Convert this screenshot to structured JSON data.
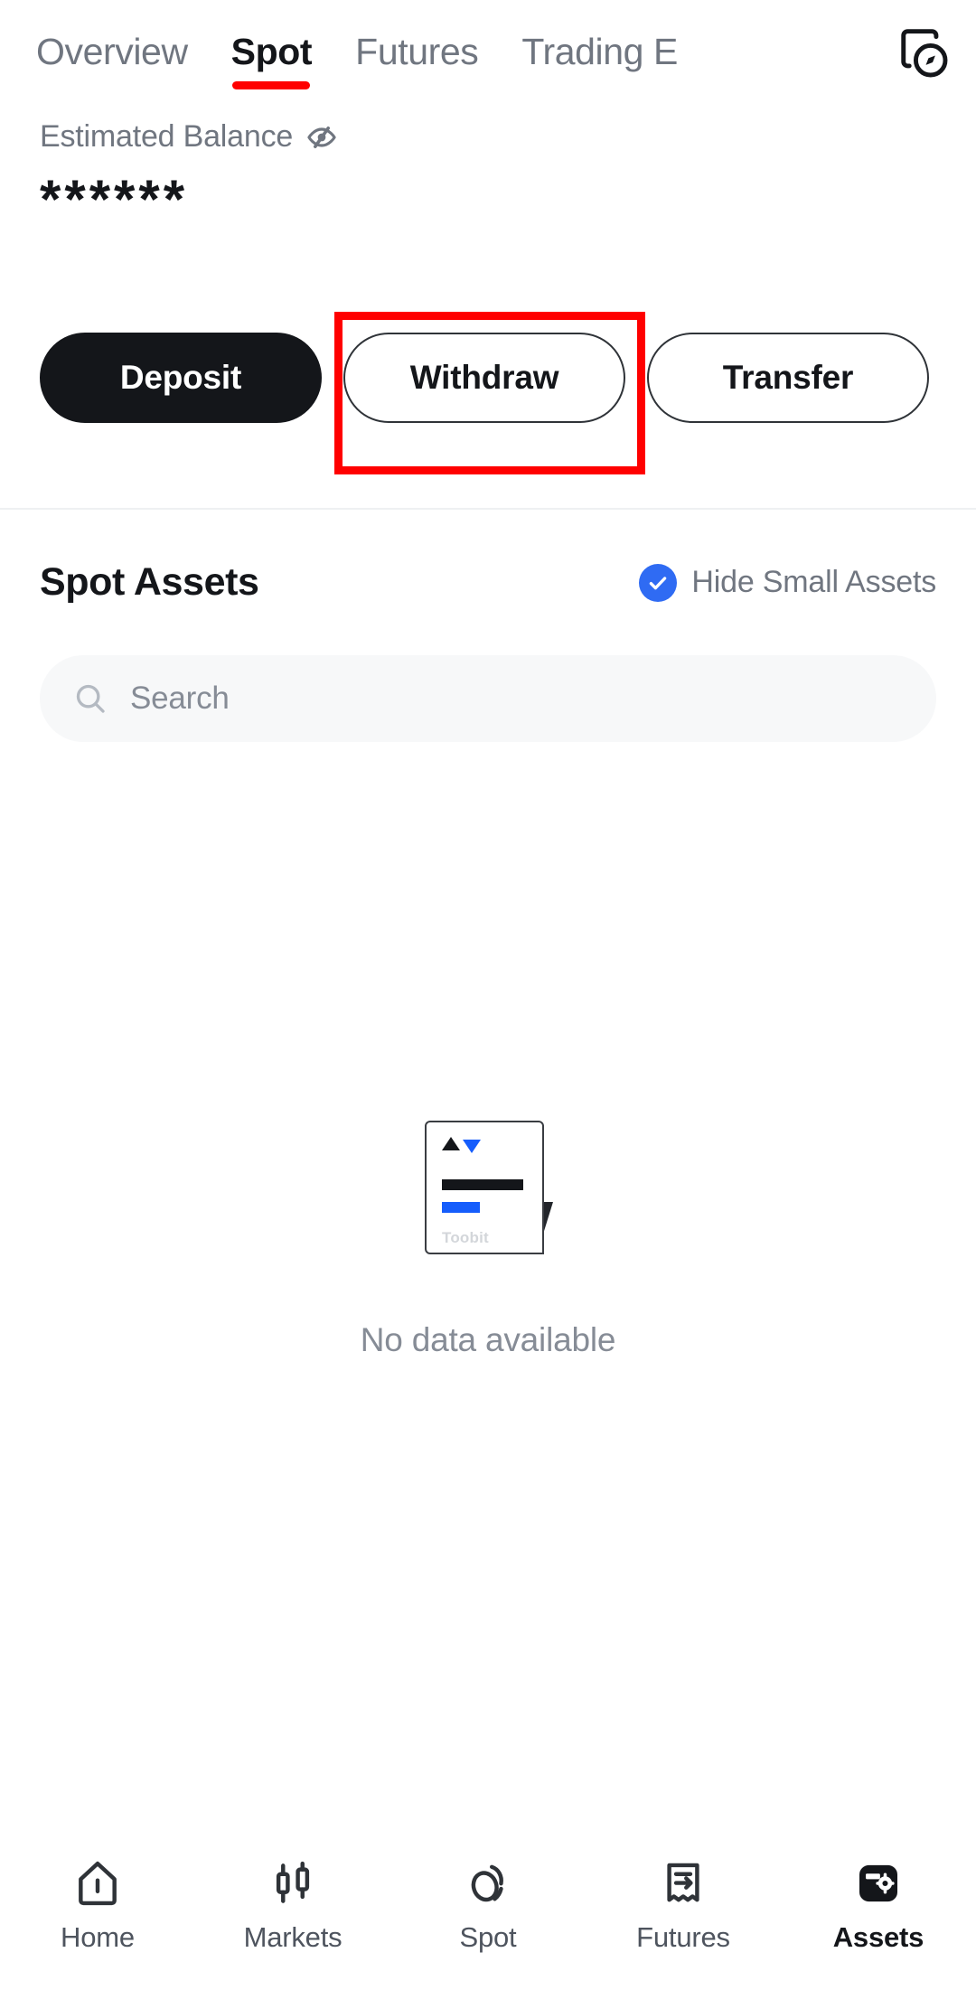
{
  "topbar": {
    "tabs": [
      {
        "label": "Overview",
        "active": false
      },
      {
        "label": "Spot",
        "active": true
      },
      {
        "label": "Futures",
        "active": false
      },
      {
        "label": "Trading E",
        "active": false
      }
    ],
    "history_icon": "history-record-icon",
    "active_underline_color": "#ff0000"
  },
  "balance": {
    "label": "Estimated Balance",
    "visibility_icon": "eye-off-icon",
    "amount": "******",
    "hidden": true
  },
  "actions": [
    {
      "label": "Deposit",
      "style": "primary",
      "highlighted": false
    },
    {
      "label": "Withdraw",
      "style": "outline",
      "highlighted": true
    },
    {
      "label": "Transfer",
      "style": "outline",
      "highlighted": false
    }
  ],
  "annotation": {
    "target": "Withdraw",
    "color": "#ff0000"
  },
  "assets_section": {
    "title": "Spot Assets",
    "hide_small_assets": {
      "label": "Hide Small Assets",
      "checked": true,
      "check_color": "#2f6bf3"
    },
    "search": {
      "placeholder": "Search",
      "value": "",
      "icon": "search-icon"
    },
    "empty_state": {
      "illustration_brand": "Toobit",
      "message": "No data available"
    }
  },
  "bottom_nav": [
    {
      "label": "Home",
      "icon": "home-icon",
      "active": false
    },
    {
      "label": "Markets",
      "icon": "candlestick-icon",
      "active": false
    },
    {
      "label": "Spot",
      "icon": "swap-circles-icon",
      "active": false
    },
    {
      "label": "Futures",
      "icon": "receipt-arrow-icon",
      "active": false
    },
    {
      "label": "Assets",
      "icon": "vault-icon",
      "active": true
    }
  ]
}
